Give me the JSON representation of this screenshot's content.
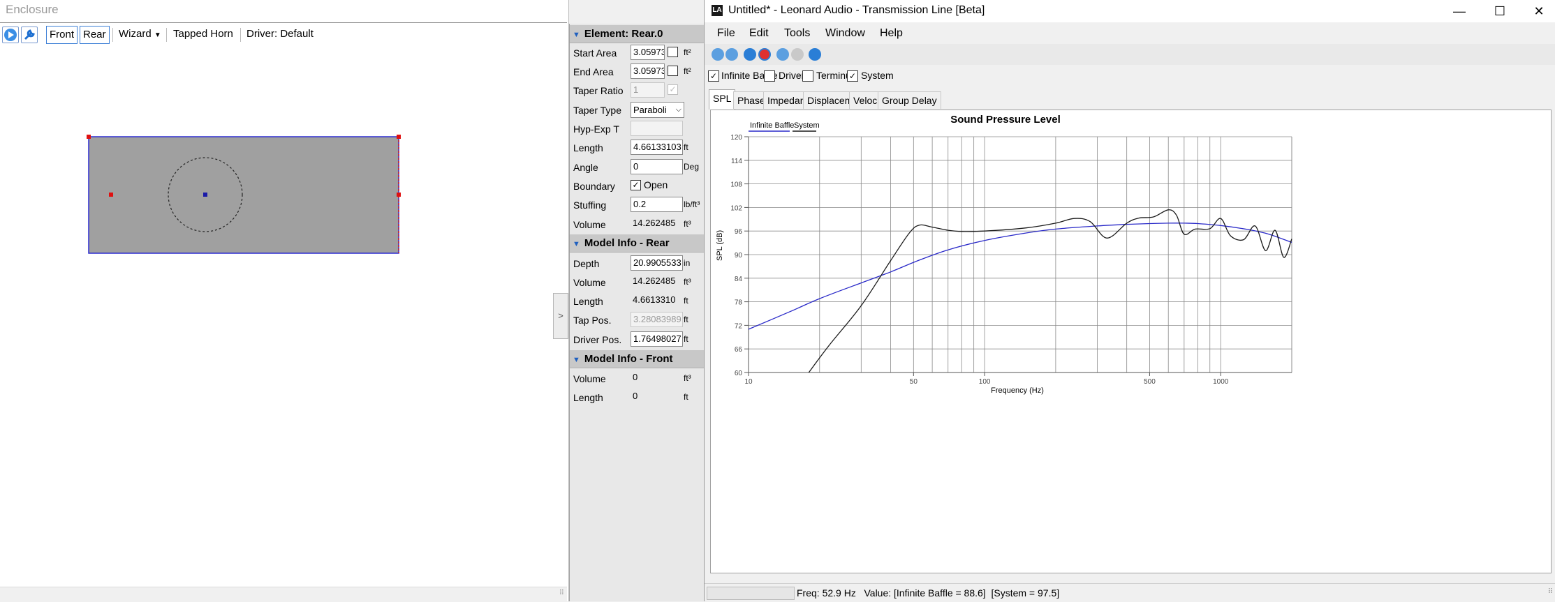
{
  "enclosure": {
    "title": "Enclosure",
    "toolbar": {
      "front": "Front",
      "rear": "Rear",
      "wizard": "Wizard",
      "tapped_horn": "Tapped Horn",
      "driver": "Driver: Default"
    }
  },
  "properties": {
    "element_header": "Element: Rear.0",
    "element_rows": [
      {
        "label": "Start Area",
        "value": "3.05973",
        "unit": "ft²"
      },
      {
        "label": "End Area",
        "value": "3.05973",
        "unit": "ft²"
      },
      {
        "label": "Taper Ratio",
        "value": "1"
      },
      {
        "label": "Taper Type",
        "value": "Paraboli"
      },
      {
        "label": "Hyp-Exp T",
        "value": ""
      },
      {
        "label": "Length",
        "value": "4.66133103",
        "unit": "ft"
      },
      {
        "label": "Angle",
        "value": "0",
        "unit": "Deg"
      },
      {
        "label": "Boundary",
        "value": "Open"
      },
      {
        "label": "Stuffing",
        "value": "0.2",
        "unit": "lb/ft³"
      },
      {
        "label": "Volume",
        "value": "14.262485",
        "unit": "ft³"
      }
    ],
    "model_rear_header": "Model Info - Rear",
    "model_rear_rows": [
      {
        "label": "Depth",
        "value": "20.9905533",
        "unit": "in"
      },
      {
        "label": "Volume",
        "value": "14.262485",
        "unit": "ft³"
      },
      {
        "label": "Length",
        "value": "4.6613310",
        "unit": "ft"
      },
      {
        "label": "Tap Pos.",
        "value": "3.28083989",
        "unit": "ft"
      },
      {
        "label": "Driver Pos.",
        "value": "1.76498027",
        "unit": "ft"
      }
    ],
    "model_front_header": "Model Info - Front",
    "model_front_rows": [
      {
        "label": "Volume",
        "value": "0",
        "unit": "ft³"
      },
      {
        "label": "Length",
        "value": "0",
        "unit": "ft"
      }
    ]
  },
  "app": {
    "logo": "LA",
    "title": "Untitled* - Leonard Audio - Transmission Line [Beta]",
    "menu": [
      "File",
      "Edit",
      "Tools",
      "Window",
      "Help"
    ],
    "checks": [
      {
        "label": "Infinite Baffle",
        "checked": true
      },
      {
        "label": "Driver",
        "checked": false
      },
      {
        "label": "Terminus",
        "checked": false
      },
      {
        "label": "System",
        "checked": true
      }
    ],
    "tabs": [
      "SPL",
      "Phase",
      "Impedance",
      "Displacement",
      "Velocity",
      "Group Delay"
    ],
    "status": "Freq: 52.9 Hz   Value: [Infinite Baffle = 88.6]  [System = 97.5]"
  },
  "chart_data": {
    "type": "line",
    "title": "Sound Pressure Level",
    "xlabel": "Frequency (Hz)",
    "ylabel": "SPL (dB)",
    "x_scale": "log",
    "xlim": [
      10,
      2000
    ],
    "ylim": [
      60,
      120
    ],
    "y_ticks": [
      60,
      66,
      72,
      78,
      84,
      90,
      96,
      102,
      108,
      114,
      120
    ],
    "x_tick_labels": [
      {
        "x": 10,
        "label": "10"
      },
      {
        "x": 50,
        "label": "50"
      },
      {
        "x": 100,
        "label": "100"
      },
      {
        "x": 500,
        "label": "500"
      },
      {
        "x": 1000,
        "label": "1000"
      }
    ],
    "grid": true,
    "legend": "top-left",
    "series": [
      {
        "name": "Infinite Baffle",
        "color": "#2828c8",
        "x": [
          10,
          15,
          20,
          30,
          40,
          52.9,
          70,
          100,
          150,
          200,
          300,
          400,
          500,
          600,
          700,
          800,
          1000,
          1300,
          1600,
          2000
        ],
        "y": [
          71,
          75.5,
          78.8,
          82.8,
          85.6,
          88.6,
          91.2,
          93.6,
          95.5,
          96.5,
          97.3,
          97.7,
          97.9,
          98.0,
          98.0,
          97.9,
          97.4,
          96.4,
          95.2,
          93.1
        ]
      },
      {
        "name": "System",
        "color": "#1a1a1a",
        "x": [
          18,
          22,
          30,
          40,
          48,
          52.9,
          60,
          70,
          80,
          100,
          150,
          200,
          240,
          280,
          330,
          400,
          450,
          520,
          600,
          650,
          700,
          780,
          900,
          1000,
          1100,
          1250,
          1400,
          1550,
          1700,
          1850,
          2000
        ],
        "y": [
          60,
          67,
          77,
          88.5,
          95.5,
          97.5,
          97,
          96.2,
          95.9,
          96,
          96.8,
          98,
          99.2,
          98.4,
          94.2,
          98,
          99.3,
          99.6,
          101.4,
          100,
          95.2,
          96.5,
          96.6,
          99.2,
          94.8,
          93.8,
          97.3,
          91,
          96.2,
          89.3,
          94
        ]
      }
    ]
  }
}
